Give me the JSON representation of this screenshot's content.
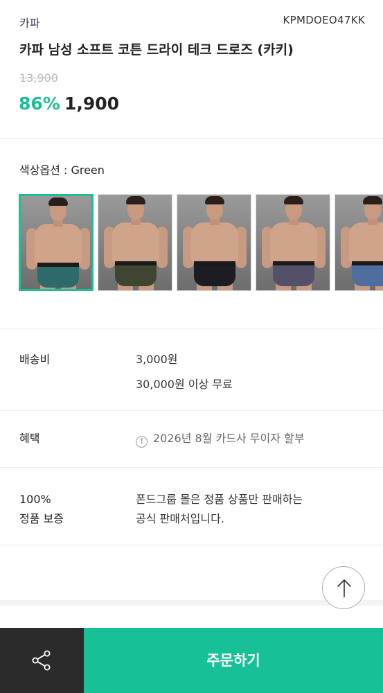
{
  "product": {
    "brand": "카파",
    "code": "KPMDOEO47KK",
    "title": "카파 남성 소프트 코튼 드라이 테크 드로즈 (카키)",
    "original_price": "13,900",
    "discount": "86%",
    "price": "1,900"
  },
  "color_option": {
    "label": "색상옵션 : Green",
    "swatches": [
      {
        "name": "green",
        "color": "#2e6a6a",
        "selected": true
      },
      {
        "name": "khaki",
        "color": "#3f4530",
        "selected": false
      },
      {
        "name": "black",
        "color": "#1c1c22",
        "selected": false
      },
      {
        "name": "purple-gray",
        "color": "#55506a",
        "selected": false
      },
      {
        "name": "blue",
        "color": "#4e6ea0",
        "selected": false
      }
    ]
  },
  "shipping": {
    "label": "배송비",
    "fee": "3,000원",
    "free_condition": "30,000원 이상 무료"
  },
  "benefit": {
    "label": "혜택",
    "text": "2026년 8월 카드사 무이자 할부"
  },
  "guarantee": {
    "label_line1": "100%",
    "label_line2": "정품 보증",
    "text_line1": "폰드그룹 몰은 정품 상품만 판매하는",
    "text_line2": "공식 판매처입니다."
  },
  "actions": {
    "order_label": "주문하기",
    "share_icon": "share-icon",
    "scroll_top_icon": "arrow-up-icon"
  },
  "colors": {
    "accent": "#17c096",
    "share_bg": "#2b2b2b"
  }
}
